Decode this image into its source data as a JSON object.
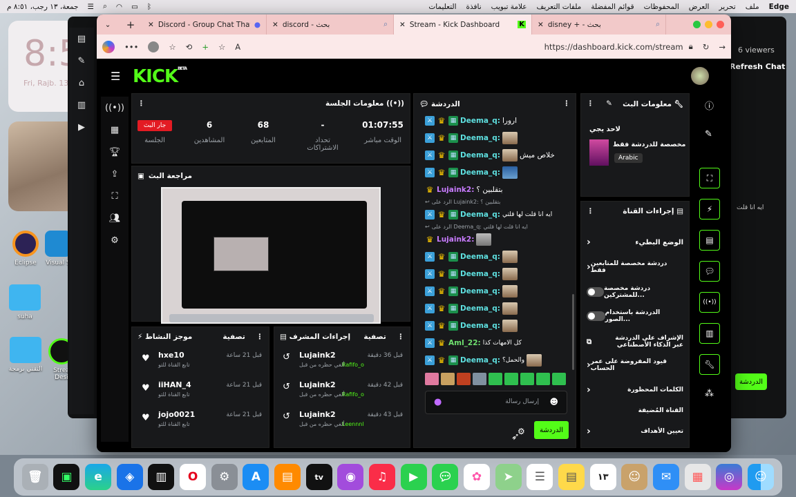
{
  "menubar": {
    "apple_right": "Edge",
    "items": [
      "ملف",
      "تحرير",
      "العرض",
      "المحفوظات",
      "قوائم المفضلة",
      "ملفات التعريف",
      "علامة تبويب",
      "نافذة",
      "التعليمات"
    ],
    "datetime": "جمعة، ١٣ رجب، ٨:٥١ م"
  },
  "desktop": {
    "clock_time": "8:5",
    "clock_date": "Fri, Rajb. 13",
    "icons": [
      "Eclipse",
      "Visual S",
      "suha",
      "التقني برمجة",
      "Strea Desi"
    ]
  },
  "browser": {
    "tabs": [
      {
        "label": "disney + - بحث"
      },
      {
        "label": "Stream - Kick Dashboard"
      },
      {
        "label": "discord - بحث"
      },
      {
        "label": "Discord - Group Chat That's All"
      }
    ],
    "url": "https://dashboard.kick.com/stream"
  },
  "background_right": {
    "viewers": "6 viewers",
    "refresh": "Refresh Chat",
    "side_text": "ايه انا قلت"
  },
  "kick": {
    "logo": "KICK",
    "logo_tag": "BETA",
    "session": {
      "title": "معلومات الجلسة",
      "stats": [
        {
          "value": "01:07:55",
          "label": "الوقت مباشر"
        },
        {
          "value": "-",
          "label": "تحداد الاشتراكات"
        },
        {
          "value": "68",
          "label": "المتابعين"
        },
        {
          "value": "6",
          "label": "المشاهدين"
        },
        {
          "value": "جار البث",
          "label": "الجلسة"
        }
      ]
    },
    "preview": {
      "title": "مراجعة البث"
    },
    "activity": {
      "title": "موجز النشاط",
      "filter": "تصفية",
      "items": [
        {
          "name": "hxe10",
          "sub": "تابع القناة للتو",
          "time": "قبل 21 ساعة"
        },
        {
          "name": "iiHAN_4",
          "sub": "تابع القناة للتو",
          "time": "قبل 21 ساعة"
        },
        {
          "name": "jojo0021",
          "sub": "تابع القناة للتو",
          "time": "قبل 21 ساعة"
        }
      ]
    },
    "mod_actions": {
      "title": "إجراءات المشرف",
      "filter": "تصفية",
      "items": [
        {
          "name": "Lujaink2",
          "sub": "ألغي حظره من قبل",
          "by": "Rafifo_o",
          "time": "قبل 36 دقيقة"
        },
        {
          "name": "Lujaink2",
          "sub": "ألغي حظره من قبل",
          "by": "Rafifo_o",
          "time": "قبل 42 دقيقة"
        },
        {
          "name": "Lujaink2",
          "sub": "ألغي حظره من قبل",
          "by": "Leennnl",
          "time": "قبل 43 دقيقة"
        }
      ]
    },
    "chat": {
      "title": "الدردشة",
      "messages": [
        {
          "user": "Deema_q:",
          "text": "ارورا",
          "style": "c"
        },
        {
          "user": "Deema_q:",
          "text": "",
          "style": "c"
        },
        {
          "user": "Deema_q:",
          "text": "خلاص ميش",
          "style": "c"
        },
        {
          "user": "Deema_q:",
          "text": "",
          "style": "c"
        },
        {
          "user": "Lujaink2:",
          "text": "بتقلبين ؟",
          "style": "p"
        },
        {
          "reply": "الرد على Lujaink2: بتقلبين ؟"
        },
        {
          "user": "Deema_q:",
          "text": "ايه انا قلت لها قلتي",
          "style": "c"
        },
        {
          "reply": "الرد على Deema_q: ايه انا قلت لها قلتي"
        },
        {
          "user": "Lujaink2:",
          "text": "",
          "style": "p"
        },
        {
          "user": "Deema_q:",
          "text": "",
          "style": "c"
        },
        {
          "user": "Deema_q:",
          "text": "",
          "style": "c"
        },
        {
          "user": "Deema_q:",
          "text": "",
          "style": "c"
        },
        {
          "user": "Deema_q:",
          "text": "",
          "style": "c"
        },
        {
          "user": "Deema_q:",
          "text": "",
          "style": "c"
        },
        {
          "user": "Aml_22:",
          "text": "كل الامهات كذا",
          "style": "g"
        },
        {
          "user": "Deema_q:",
          "text": "والحمل؟",
          "style": "c"
        }
      ],
      "placeholder": "إرسال رسالة",
      "send": "الدردشة"
    },
    "stream_info": {
      "title": "معلومات البث",
      "stream_title": "لاحد يجي",
      "category": "مخصصة للدردشة فقط",
      "language": "Arabic"
    },
    "channel_actions": {
      "title": "إجراءات القناة",
      "items": [
        {
          "label": "الوضع البطيء",
          "type": "arrow"
        },
        {
          "label": "دردشة مخصصة للمتابعين فقط",
          "type": "arrow"
        },
        {
          "label": "دردشة مخصصة للمشتركين...",
          "type": "toggle"
        },
        {
          "label": "الدردشة باستخدام الصور...",
          "type": "toggle"
        },
        {
          "label": "الإشراف على الدردشة عبر الذكاء الأصطناعي",
          "type": "ext"
        },
        {
          "label": "قيود المفروضة على عمر الحساب",
          "type": "arrow"
        },
        {
          "label": "الكلمات المحظورة",
          "type": "arrow"
        },
        {
          "label": "القناة المُضيفة",
          "type": "none"
        },
        {
          "label": "تعيين الأهداف",
          "type": "arrow"
        }
      ]
    }
  }
}
